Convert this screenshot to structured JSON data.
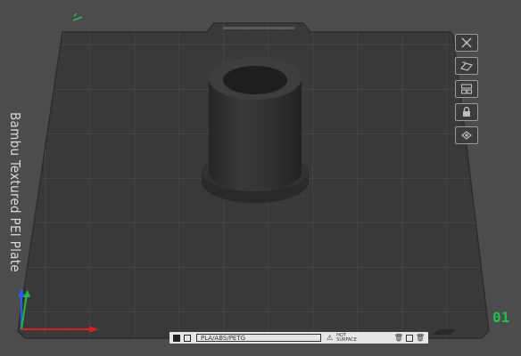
{
  "plate": {
    "title": "Bambu Textured PEI Plate",
    "index": "01",
    "label": {
      "filament_types": "PLA/ABS/PETG",
      "warning_line1": "HOT",
      "warning_line2": "SURFACE"
    }
  },
  "toolbar": {
    "items": [
      {
        "name": "close-icon"
      },
      {
        "name": "auto-orient-icon"
      },
      {
        "name": "arrange-icon"
      },
      {
        "name": "lock-icon"
      },
      {
        "name": "settings-icon"
      }
    ]
  },
  "colors": {
    "background": "#4c4c4e",
    "plate": "#38383a",
    "grid": "#4a4a4c",
    "model": "#2a2a2c",
    "accent": "#1fc14d",
    "axis_x": "#d42222",
    "axis_y": "#23b83a",
    "axis_z": "#2a5ce6"
  }
}
